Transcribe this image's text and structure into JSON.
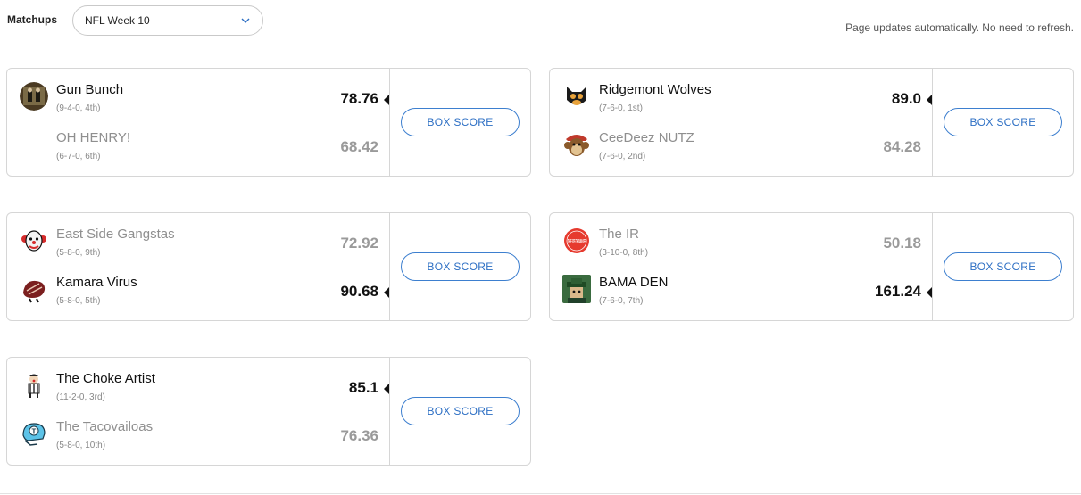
{
  "header": {
    "matchups_label": "Matchups",
    "week_selected": "NFL Week 10",
    "auto_update_note": "Page updates automatically. No need to refresh."
  },
  "matchups": [
    {
      "box_score_label": "BOX SCORE",
      "teams": [
        {
          "name": "Gun Bunch",
          "record": "(9-4-0, 4th)",
          "score": "78.76",
          "winner": true,
          "avatar": "gun-bunch-avatar"
        },
        {
          "name": "OH HENRY!",
          "record": "(6-7-0, 6th)",
          "score": "68.42",
          "winner": false,
          "avatar": ""
        }
      ]
    },
    {
      "box_score_label": "BOX SCORE",
      "teams": [
        {
          "name": "Ridgemont Wolves",
          "record": "(7-6-0, 1st)",
          "score": "89.0",
          "winner": true,
          "avatar": "wolf-avatar"
        },
        {
          "name": "CeeDeez NUTZ",
          "record": "(7-6-0, 2nd)",
          "score": "84.28",
          "winner": false,
          "avatar": "monkey-avatar"
        }
      ]
    },
    {
      "box_score_label": "BOX SCORE",
      "teams": [
        {
          "name": "East Side Gangstas",
          "record": "(5-8-0, 9th)",
          "score": "72.92",
          "winner": false,
          "avatar": "clown-avatar"
        },
        {
          "name": "Kamara Virus",
          "record": "(5-8-0, 5th)",
          "score": "90.68",
          "winner": true,
          "avatar": "steak-avatar"
        }
      ]
    },
    {
      "box_score_label": "BOX SCORE",
      "teams": [
        {
          "name": "The IR",
          "record": "(3-10-0, 8th)",
          "score": "50.18",
          "winner": false,
          "avatar": "badge-avatar"
        },
        {
          "name": "BAMA DEN",
          "record": "(7-6-0, 7th)",
          "score": "161.24",
          "winner": true,
          "avatar": "hat-avatar"
        }
      ]
    },
    {
      "box_score_label": "BOX SCORE",
      "teams": [
        {
          "name": "The Choke Artist",
          "record": "(11-2-0, 3rd)",
          "score": "85.1",
          "winner": true,
          "avatar": "referee-avatar"
        },
        {
          "name": "The Tacovailoas",
          "record": "(5-8-0, 10th)",
          "score": "76.36",
          "winner": false,
          "avatar": "helmet-avatar"
        }
      ]
    }
  ],
  "badge_text": "THERE GOES THE DAMN KNEE"
}
